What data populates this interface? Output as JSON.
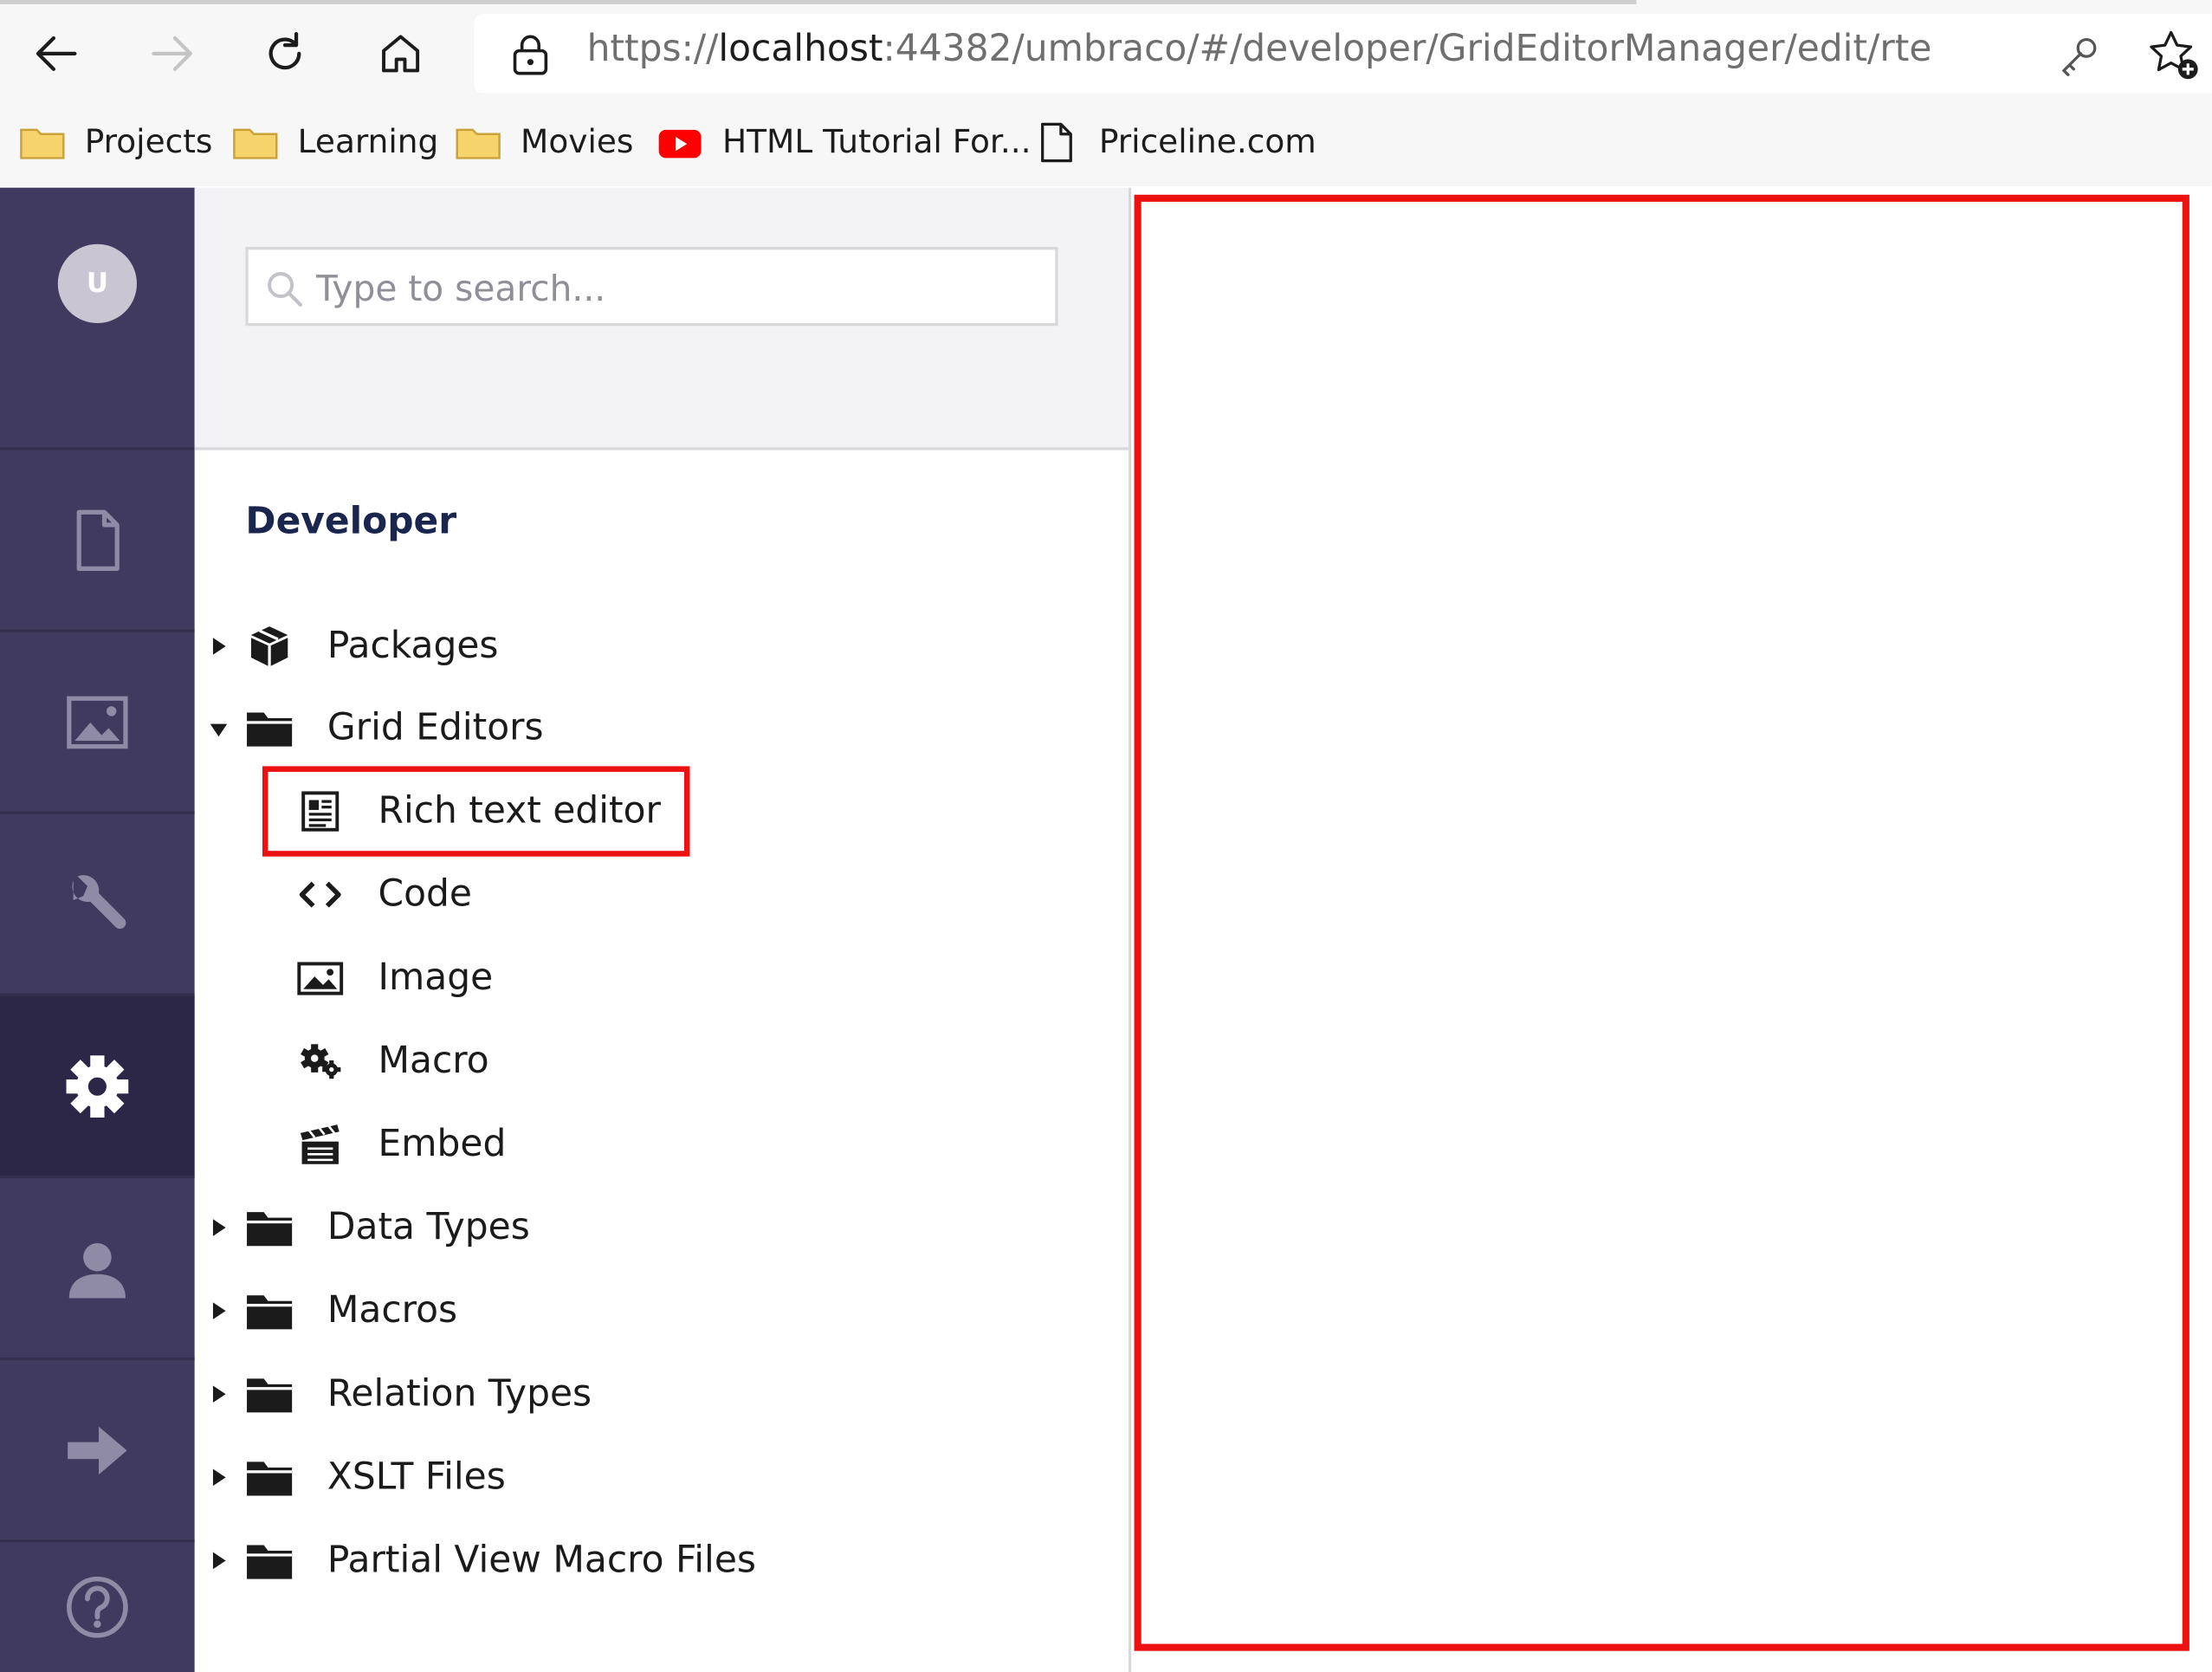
{
  "browser": {
    "url_prefix": "https://",
    "url_host": "localhost",
    "url_rest": ":44382/umbraco/#/developer/GridEditorManager/edit/rte",
    "bookmarks": [
      {
        "label": "Projects",
        "icon": "folder-icon"
      },
      {
        "label": "Learning",
        "icon": "folder-icon"
      },
      {
        "label": "Movies",
        "icon": "folder-icon"
      },
      {
        "label": "HTML Tutorial For...",
        "icon": "youtube-icon"
      },
      {
        "label": "Priceline.com",
        "icon": "page-icon"
      }
    ]
  },
  "sections": {
    "avatar_initial": "U",
    "items": [
      {
        "name": "content",
        "icon": "document-icon"
      },
      {
        "name": "media",
        "icon": "image-icon"
      },
      {
        "name": "settings",
        "icon": "wrench-icon"
      },
      {
        "name": "developer",
        "icon": "gear-icon",
        "active": true
      },
      {
        "name": "users",
        "icon": "user-icon"
      },
      {
        "name": "forms",
        "icon": "arrow-right-icon"
      },
      {
        "name": "help",
        "icon": "help-icon"
      }
    ],
    "active_bg": "#2c2746",
    "bg": "#403a5e"
  },
  "search": {
    "placeholder": "Type to search...",
    "value": ""
  },
  "tree": {
    "title": "Developer",
    "nodes": [
      {
        "label": "Packages",
        "icon": "package-icon",
        "expanded": false
      },
      {
        "label": "Grid Editors",
        "icon": "folder-icon",
        "expanded": true,
        "children": [
          {
            "label": "Rich text editor",
            "icon": "rte-icon",
            "selected": true
          },
          {
            "label": "Code",
            "icon": "code-icon"
          },
          {
            "label": "Image",
            "icon": "picture-icon"
          },
          {
            "label": "Macro",
            "icon": "gears-icon"
          },
          {
            "label": "Embed",
            "icon": "clapper-icon"
          }
        ]
      },
      {
        "label": "Data Types",
        "icon": "folder-icon",
        "expanded": false
      },
      {
        "label": "Macros",
        "icon": "folder-icon",
        "expanded": false
      },
      {
        "label": "Relation Types",
        "icon": "folder-icon",
        "expanded": false
      },
      {
        "label": "XSLT Files",
        "icon": "folder-icon",
        "expanded": false
      },
      {
        "label": "Partial View Macro Files",
        "icon": "folder-icon",
        "expanded": false
      }
    ]
  },
  "highlight_color": "#ee1111"
}
